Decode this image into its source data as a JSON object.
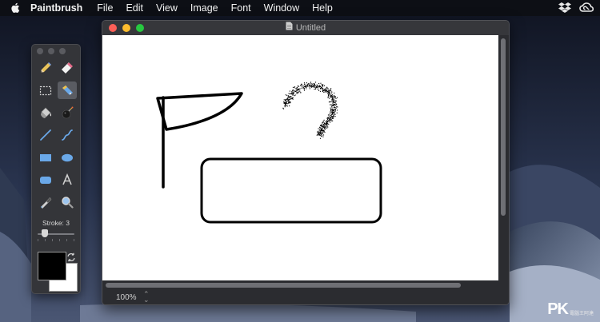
{
  "menubar": {
    "app_name": "Paintbrush",
    "items": [
      "File",
      "Edit",
      "View",
      "Image",
      "Font",
      "Window",
      "Help"
    ],
    "status_icons": [
      "dropbox-icon",
      "creative-cloud-icon"
    ]
  },
  "tools_palette": {
    "tools": [
      {
        "name": "pencil-tool",
        "selected": false
      },
      {
        "name": "eraser-tool",
        "selected": false
      },
      {
        "name": "selection-tool",
        "selected": false
      },
      {
        "name": "airbrush-tool",
        "selected": true
      },
      {
        "name": "paint-bucket-tool",
        "selected": false
      },
      {
        "name": "bomb-tool",
        "selected": false
      },
      {
        "name": "line-tool",
        "selected": false
      },
      {
        "name": "curve-tool",
        "selected": false
      },
      {
        "name": "rectangle-tool",
        "selected": false
      },
      {
        "name": "ellipse-tool",
        "selected": false
      },
      {
        "name": "rounded-rectangle-tool",
        "selected": false
      },
      {
        "name": "text-tool",
        "selected": false
      },
      {
        "name": "eyedropper-tool",
        "selected": false
      },
      {
        "name": "zoom-tool",
        "selected": false
      }
    ],
    "stroke_label": "Stroke: 3",
    "stroke_level_fraction": 0.2,
    "foreground_color": "#000000",
    "background_color": "#ffffff"
  },
  "document_window": {
    "title": "Untitled",
    "zoom": "100%"
  },
  "watermark": {
    "logo": "PK",
    "tagline": "電腦王阿達"
  },
  "colors": {
    "menubar_bg": "#0d0f15",
    "palette_bg": "#343539",
    "window_bg": "#2b2c30",
    "close": "#fc5f57",
    "minimize": "#fdbc2e",
    "zoom": "#27c840"
  }
}
